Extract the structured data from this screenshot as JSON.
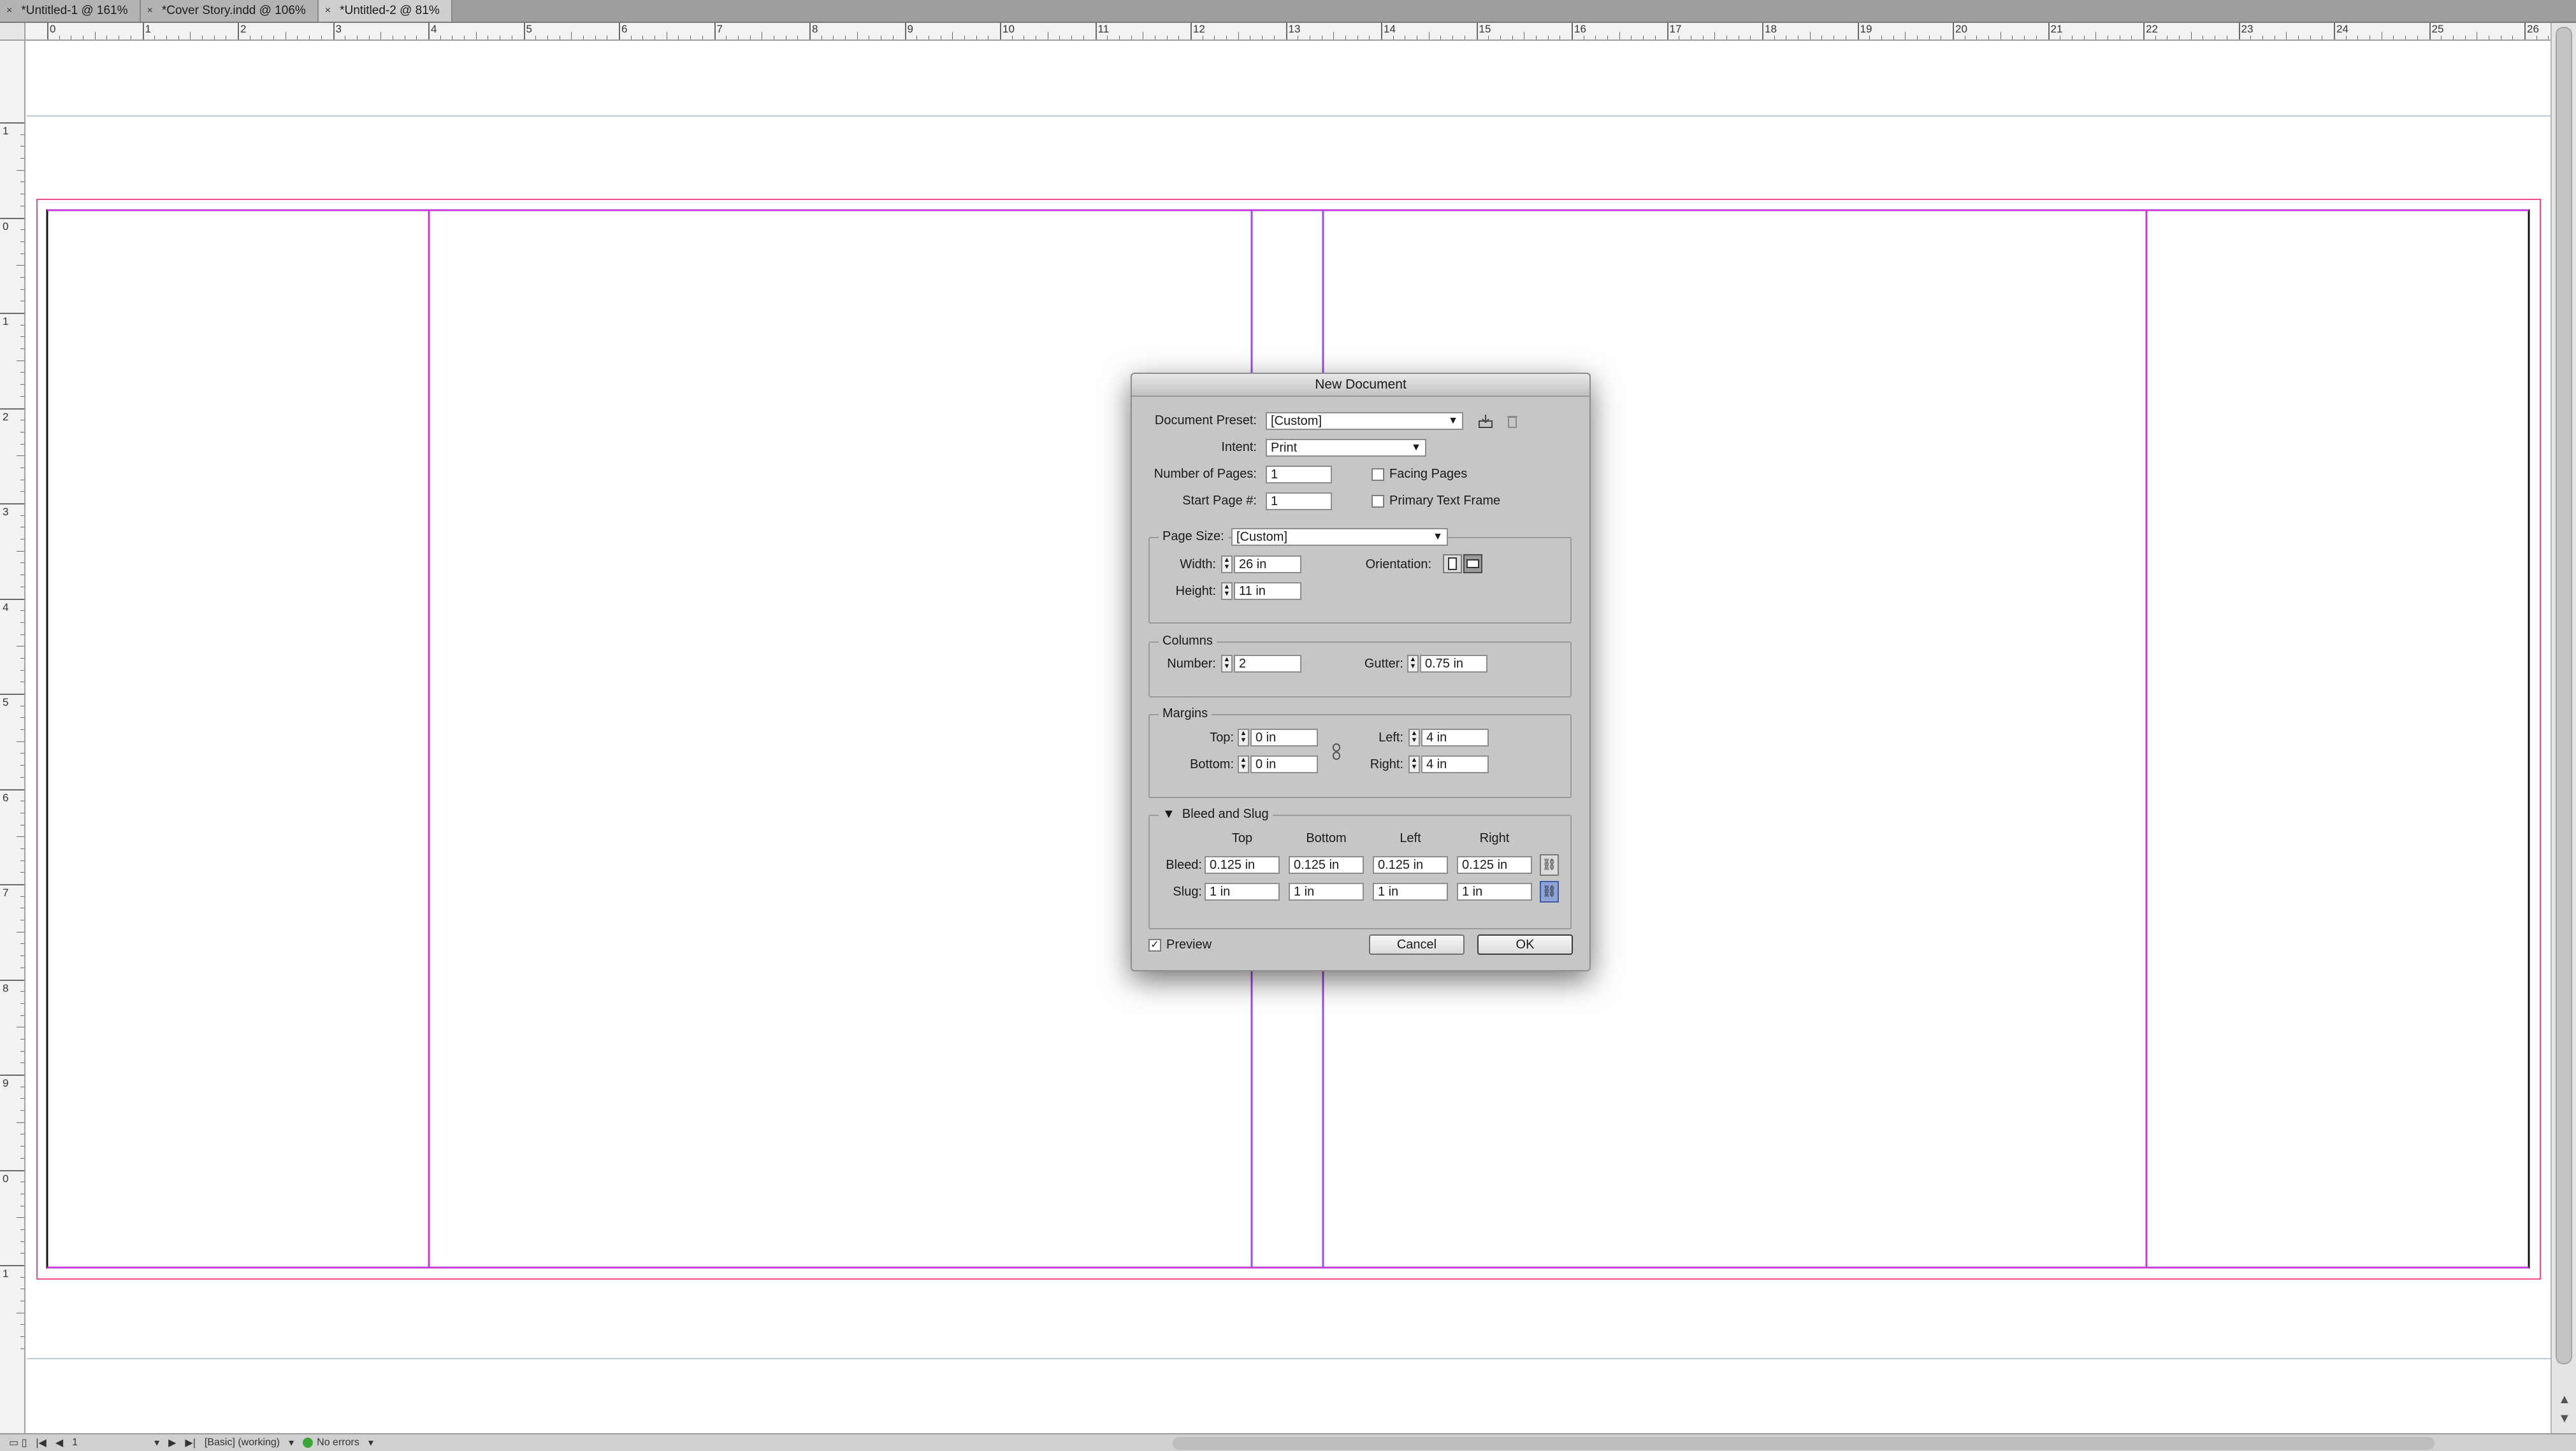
{
  "tabs": [
    {
      "close": "×",
      "label": "*Untitled-1 @ 161%"
    },
    {
      "close": "×",
      "label": "*Cover Story.indd @ 106%"
    },
    {
      "close": "×",
      "label": "*Untitled-2 @ 81%"
    }
  ],
  "active_tab": 2,
  "rulers": {
    "horizontal": [
      "0",
      "1",
      "2",
      "3",
      "4",
      "5",
      "6",
      "7",
      "8",
      "9",
      "10",
      "11",
      "12",
      "13",
      "14",
      "15",
      "16",
      "17",
      "18",
      "19",
      "20",
      "21",
      "22",
      "23",
      "24",
      "25",
      "26"
    ],
    "vertical": [
      "1",
      "0",
      "1",
      "2",
      "3",
      "4",
      "5",
      "6",
      "7",
      "8",
      "9",
      "0",
      "1"
    ]
  },
  "colors": {
    "margin_guide": "#c53bd3",
    "bleed_guide": "#f04b8c",
    "slug_guide": "#b9cdd6",
    "page_edge": "#000000"
  },
  "dialog": {
    "title": "New Document",
    "document_preset": {
      "label": "Document Preset:",
      "value": "[Custom]"
    },
    "intent": {
      "label": "Intent:",
      "value": "Print"
    },
    "number_of_pages": {
      "label": "Number of Pages:",
      "value": "1"
    },
    "start_page": {
      "label": "Start Page #:",
      "value": "1"
    },
    "facing_pages": {
      "label": "Facing Pages",
      "checked": false
    },
    "primary_text_frame": {
      "label": "Primary Text Frame",
      "checked": false
    },
    "page_size": {
      "label": "Page Size:",
      "value": "[Custom]"
    },
    "width": {
      "label": "Width:",
      "value": "26 in"
    },
    "height": {
      "label": "Height:",
      "value": "11 in"
    },
    "orientation": {
      "label": "Orientation:"
    },
    "columns": {
      "legend": "Columns",
      "number_label": "Number:",
      "number": "2",
      "gutter_label": "Gutter:",
      "gutter": "0.75 in"
    },
    "margins": {
      "legend": "Margins",
      "top_label": "Top:",
      "top": "0 in",
      "bottom_label": "Bottom:",
      "bottom": "0 in",
      "left_label": "Left:",
      "left": "4 in",
      "right_label": "Right:",
      "right": "4 in"
    },
    "bleed_slug": {
      "legend": "Bleed and Slug",
      "col_top": "Top",
      "col_bottom": "Bottom",
      "col_left": "Left",
      "col_right": "Right",
      "bleed_label": "Bleed:",
      "bleed": [
        "0.125 in",
        "0.125 in",
        "0.125 in",
        "0.125 in"
      ],
      "slug_label": "Slug:",
      "slug": [
        "1 in",
        "1 in",
        "1 in",
        "1 in"
      ]
    },
    "preview": {
      "label": "Preview",
      "checked": true
    },
    "cancel": "Cancel",
    "ok": "OK"
  },
  "status": {
    "page": "1",
    "style": "[Basic] (working)",
    "errors": "No errors"
  },
  "icons": [
    "save-preset-icon",
    "delete-preset-icon",
    "portrait-orientation-icon",
    "landscape-orientation-icon",
    "chain-link-icon",
    "disclosure-triangle-icon"
  ]
}
